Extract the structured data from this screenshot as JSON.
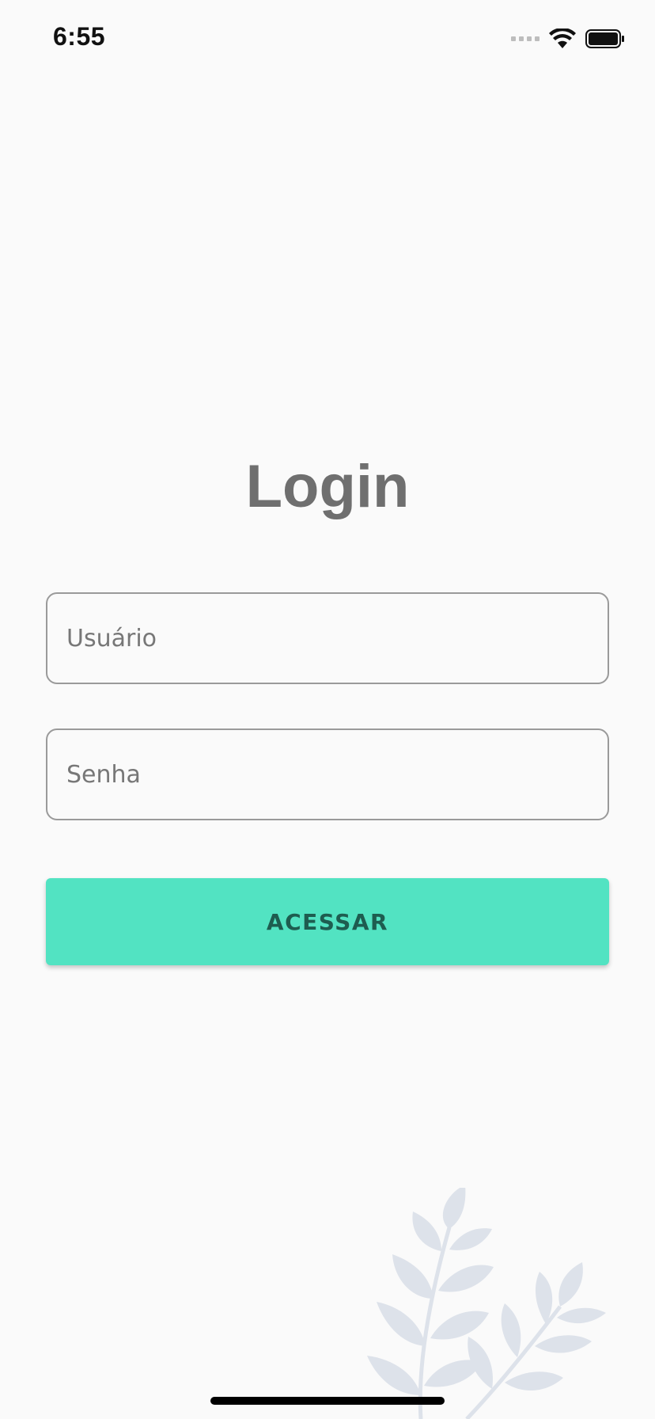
{
  "status_bar": {
    "time": "6:55",
    "icons": [
      "cellular-signal-icon",
      "wifi-icon",
      "battery-icon"
    ]
  },
  "login": {
    "title": "Login",
    "username_placeholder": "Usuário",
    "password_placeholder": "Senha",
    "submit_label": "ACESSAR"
  },
  "colors": {
    "background": "#fafafa",
    "accent": "#52e3c2",
    "button_text": "#1e5d50",
    "title_text": "#6f6f6f",
    "field_border": "#9a9a9a",
    "leaf": "#dde2ea"
  }
}
